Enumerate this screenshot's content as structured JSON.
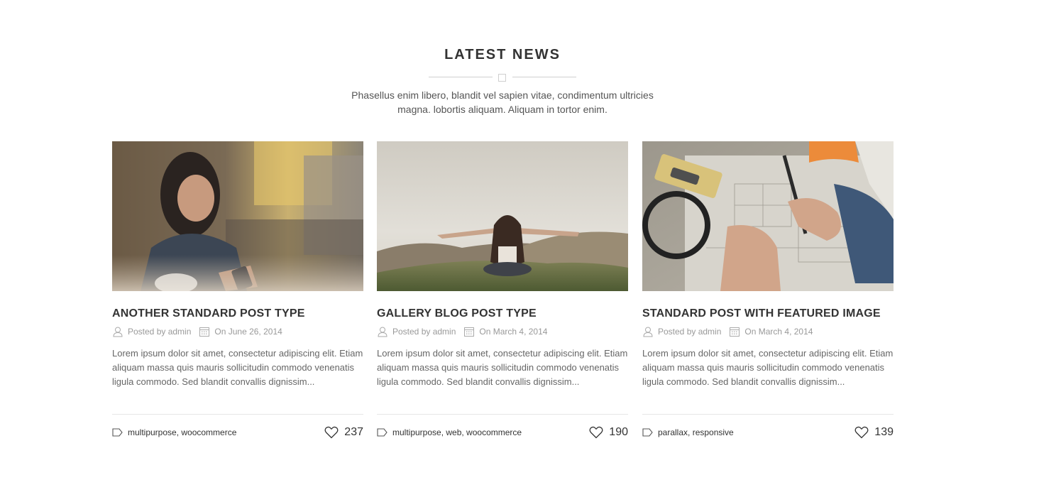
{
  "section": {
    "title": "LATEST NEWS",
    "intro": "Phasellus enim libero, blandit vel sapien vitae, condimentum ultricies magna. lobortis aliquam. Aliquam in tortor enim."
  },
  "posts": [
    {
      "title": "ANOTHER STANDARD POST TYPE",
      "author": "Posted by admin",
      "date": "On June 26, 2014",
      "excerpt": "Lorem ipsum dolor sit amet, consectetur adipiscing elit. Etiam aliquam massa quis mauris sollicitudin commodo venenatis ligula commodo. Sed blandit convallis dignissim...",
      "tags": "multipurpose, woocommerce",
      "likes": "237",
      "image": "woman-cafe-phone-photo"
    },
    {
      "title": "GALLERY BLOG POST TYPE",
      "author": "Posted by admin",
      "date": "On March 4, 2014",
      "excerpt": "Lorem ipsum dolor sit amet, consectetur adipiscing elit. Etiam aliquam massa quis mauris sollicitudin commodo venenatis ligula commodo. Sed blandit convallis dignissim...",
      "tags": "multipurpose, web, woocommerce",
      "likes": "190",
      "image": "woman-hilltop-arms-open-photo"
    },
    {
      "title": "STANDARD POST WITH FEATURED IMAGE",
      "author": "Posted by admin",
      "date": "On March 4, 2014",
      "excerpt": "Lorem ipsum dolor sit amet, consectetur adipiscing elit. Etiam aliquam massa quis mauris sollicitudin commodo venenatis ligula commodo. Sed blandit convallis dignissim...",
      "tags": "parallax, responsive",
      "likes": "139",
      "image": "architect-blueprint-drawing-photo"
    }
  ],
  "icons": {
    "author": "user-icon",
    "date": "calendar-icon",
    "tags": "tag-icon",
    "likes": "heart-icon"
  },
  "colors": {
    "title": "#333333",
    "meta": "#999999",
    "text": "#666666",
    "divider": "#cfcfcf"
  }
}
